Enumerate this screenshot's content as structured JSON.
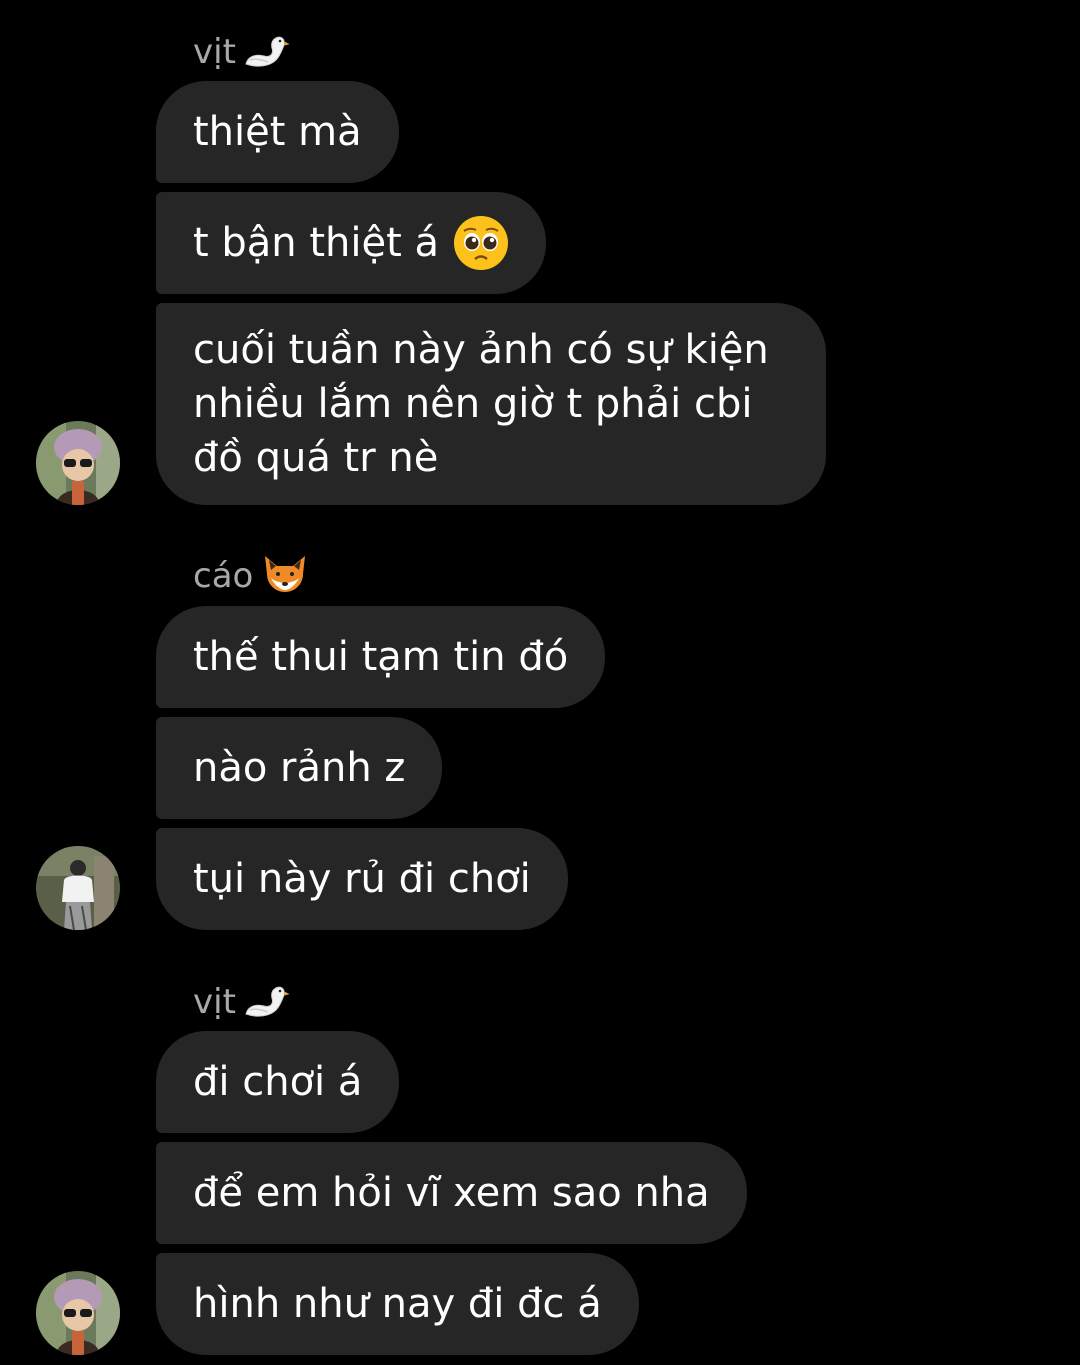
{
  "conversation": {
    "groups": [
      {
        "sender_name": "vịt",
        "sender_emoji": "swan-icon",
        "messages": [
          "thiệt mà",
          "t bận thiệt á",
          "cuối tuần này ảnh có sự kiện nhiều lắm nên giờ t phải cbi đồ quá tr nè"
        ],
        "inline_emoji": "pleading-face-icon"
      },
      {
        "sender_name": "cáo",
        "sender_emoji": "fox-icon",
        "messages": [
          "thế thui tạm tin đó",
          "nào rảnh z",
          "tụi này rủ đi chơi"
        ]
      },
      {
        "sender_name": "vịt",
        "sender_emoji": "swan-icon",
        "messages": [
          "đi chơi á",
          "để em hỏi vĩ xem sao nha",
          "hình như nay đi đc á"
        ]
      }
    ]
  },
  "colors": {
    "background": "#000000",
    "bubble": "#262626",
    "sender_text": "#a8a8a8",
    "message_text": "#ffffff"
  }
}
